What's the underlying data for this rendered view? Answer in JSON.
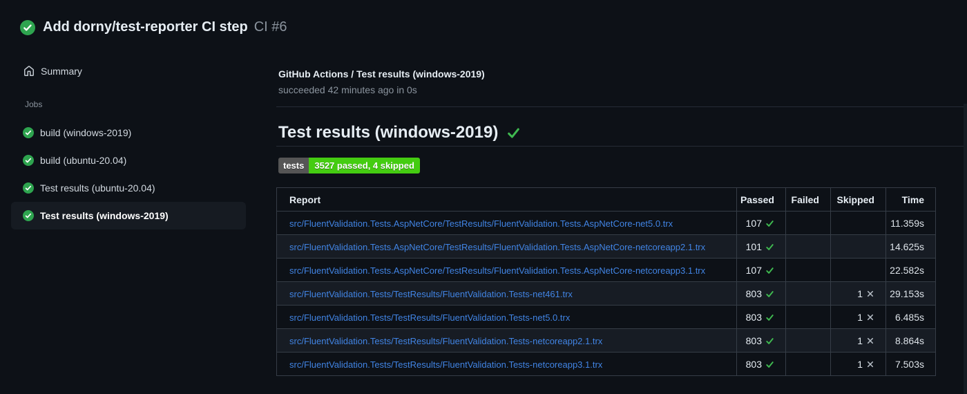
{
  "header": {
    "status_icon": "check-circle-icon",
    "title": "Add dorny/test-reporter CI step",
    "run_label": "CI #6"
  },
  "sidebar": {
    "summary_label": "Summary",
    "summary_icon": "home-icon",
    "jobs_label": "Jobs",
    "jobs": [
      {
        "label": "build (windows-2019)",
        "status": "success",
        "selected": false
      },
      {
        "label": "build (ubuntu-20.04)",
        "status": "success",
        "selected": false
      },
      {
        "label": "Test results (ubuntu-20.04)",
        "status": "success",
        "selected": false
      },
      {
        "label": "Test results (windows-2019)",
        "status": "success",
        "selected": true
      }
    ]
  },
  "main": {
    "check_title": "GitHub Actions / Test results (windows-2019)",
    "check_subtitle": "succeeded 42 minutes ago in 0s",
    "section_title": "Test results (windows-2019)",
    "section_status_icon": "check-icon",
    "badge": {
      "label": "tests",
      "value": "3527 passed, 4 skipped",
      "label_bg": "#555555",
      "value_bg": "#44cc11"
    },
    "table": {
      "headers": [
        "Report",
        "Passed",
        "Failed",
        "Skipped",
        "Time"
      ],
      "rows": [
        {
          "report": "src/FluentValidation.Tests.AspNetCore/TestResults/FluentValidation.Tests.AspNetCore-net5.0.trx",
          "passed": "107",
          "failed": "",
          "skipped": "",
          "time": "11.359s"
        },
        {
          "report": "src/FluentValidation.Tests.AspNetCore/TestResults/FluentValidation.Tests.AspNetCore-netcoreapp2.1.trx",
          "passed": "101",
          "failed": "",
          "skipped": "",
          "time": "14.625s"
        },
        {
          "report": "src/FluentValidation.Tests.AspNetCore/TestResults/FluentValidation.Tests.AspNetCore-netcoreapp3.1.trx",
          "passed": "107",
          "failed": "",
          "skipped": "",
          "time": "22.582s"
        },
        {
          "report": "src/FluentValidation.Tests/TestResults/FluentValidation.Tests-net461.trx",
          "passed": "803",
          "failed": "",
          "skipped": "1",
          "time": "29.153s"
        },
        {
          "report": "src/FluentValidation.Tests/TestResults/FluentValidation.Tests-net5.0.trx",
          "passed": "803",
          "failed": "",
          "skipped": "1",
          "time": "6.485s"
        },
        {
          "report": "src/FluentValidation.Tests/TestResults/FluentValidation.Tests-netcoreapp2.1.trx",
          "passed": "803",
          "failed": "",
          "skipped": "1",
          "time": "8.864s"
        },
        {
          "report": "src/FluentValidation.Tests/TestResults/FluentValidation.Tests-netcoreapp3.1.trx",
          "passed": "803",
          "failed": "",
          "skipped": "1",
          "time": "7.503s"
        }
      ]
    }
  },
  "colors": {
    "page_bg": "#0d1117",
    "success_green": "#2ea44f",
    "check_green": "#3fb950",
    "skip_gray": "#b4bcc4",
    "link_blue": "#4184e4",
    "muted_text": "#8b949e",
    "row_alt_bg": "#171c24",
    "table_border": "#363d47"
  }
}
